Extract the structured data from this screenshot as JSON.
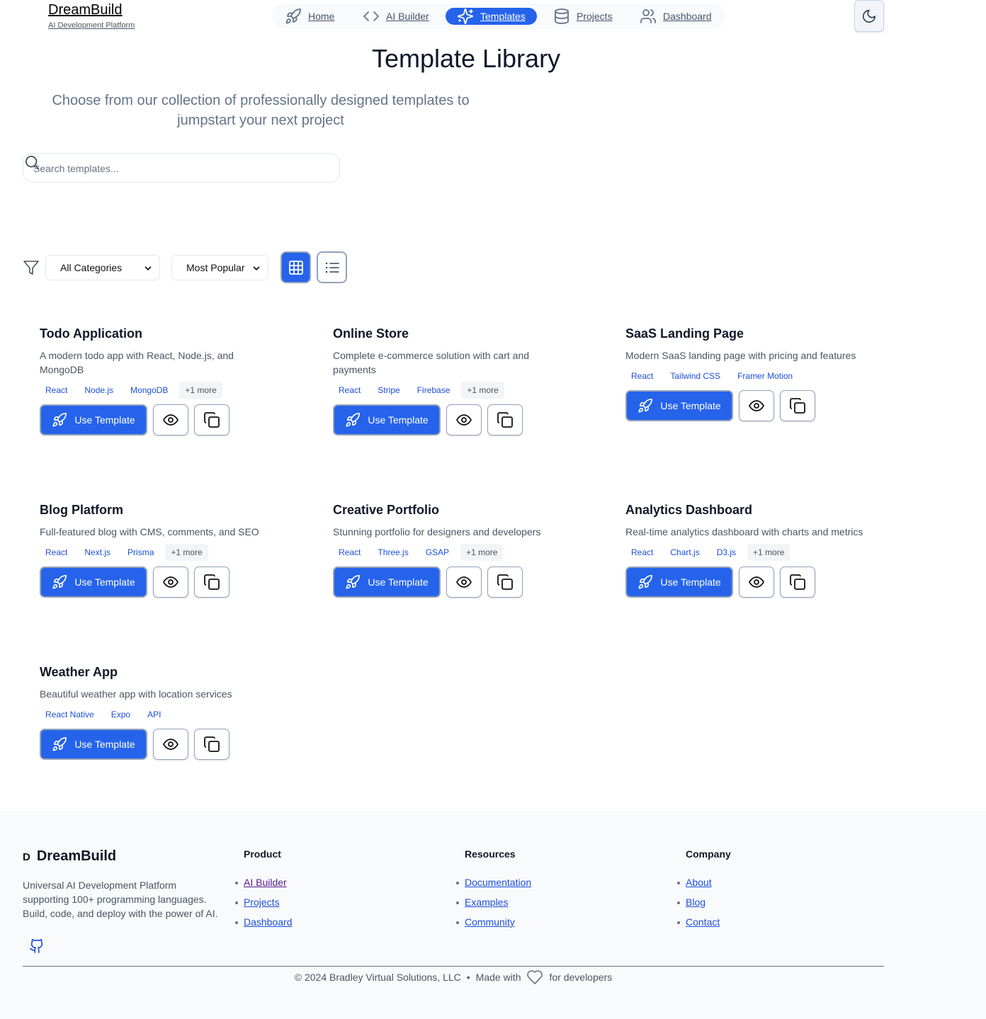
{
  "brand": {
    "name": "DreamBuild",
    "tagline": "AI Development Platform"
  },
  "nav": {
    "items": [
      {
        "label": "Home",
        "icon": "rocket-icon"
      },
      {
        "label": "AI Builder",
        "icon": "code-icon"
      },
      {
        "label": "Templates",
        "icon": "sparkles-icon",
        "active": true
      },
      {
        "label": "Projects",
        "icon": "database-icon"
      },
      {
        "label": "Dashboard",
        "icon": "users-icon"
      }
    ],
    "theme_icon": "moon-icon"
  },
  "hero": {
    "title": "Template Library",
    "subtitle": "Choose from our collection of professionally designed templates to jumpstart your next project"
  },
  "search": {
    "placeholder": "Search templates...",
    "value": ""
  },
  "filters": {
    "category": "All Categories",
    "sort": "Most Popular",
    "view": "grid"
  },
  "templates": [
    {
      "title": "Todo Application",
      "description": "A modern todo app with React, Node.js, and MongoDB",
      "tags": [
        "React",
        "Node.js",
        "MongoDB"
      ],
      "more": "+1 more"
    },
    {
      "title": "Online Store",
      "description": "Complete e-commerce solution with cart and payments",
      "tags": [
        "React",
        "Stripe",
        "Firebase"
      ],
      "more": "+1 more"
    },
    {
      "title": "SaaS Landing Page",
      "description": "Modern SaaS landing page with pricing and features",
      "tags": [
        "React",
        "Tailwind CSS",
        "Framer Motion"
      ],
      "more": ""
    },
    {
      "title": "Blog Platform",
      "description": "Full-featured blog with CMS, comments, and SEO",
      "tags": [
        "React",
        "Next.js",
        "Prisma"
      ],
      "more": "+1 more"
    },
    {
      "title": "Creative Portfolio",
      "description": "Stunning portfolio for designers and developers",
      "tags": [
        "React",
        "Three.js",
        "GSAP"
      ],
      "more": "+1 more"
    },
    {
      "title": "Analytics Dashboard",
      "description": "Real-time analytics dashboard with charts and metrics",
      "tags": [
        "React",
        "Chart.js",
        "D3.js"
      ],
      "more": "+1 more"
    },
    {
      "title": "Weather App",
      "description": "Beautiful weather app with location services",
      "tags": [
        "React Native",
        "Expo",
        "API"
      ],
      "more": ""
    }
  ],
  "card_actions": {
    "use_label": "Use Template",
    "preview_icon": "eye-icon",
    "copy_icon": "copy-icon"
  },
  "footer": {
    "logo_letter": "D",
    "name": "DreamBuild",
    "description": "Universal AI Development Platform supporting 100+ programming languages. Build, code, and deploy with the power of AI.",
    "columns": [
      {
        "title": "Product",
        "links": [
          "AI Builder",
          "Projects",
          "Dashboard"
        ]
      },
      {
        "title": "Resources",
        "links": [
          "Documentation",
          "Examples",
          "Community"
        ]
      },
      {
        "title": "Company",
        "links": [
          "About",
          "Blog",
          "Contact"
        ]
      }
    ],
    "copyright": "© 2024 Bradley Virtual Solutions, LLC",
    "separator": "•",
    "made_with": "Made with",
    "for_devs": "for developers"
  },
  "colors": {
    "accent": "#2563eb",
    "text": "#111827",
    "muted": "#4b5563",
    "footer_bg": "#f8fafc"
  }
}
